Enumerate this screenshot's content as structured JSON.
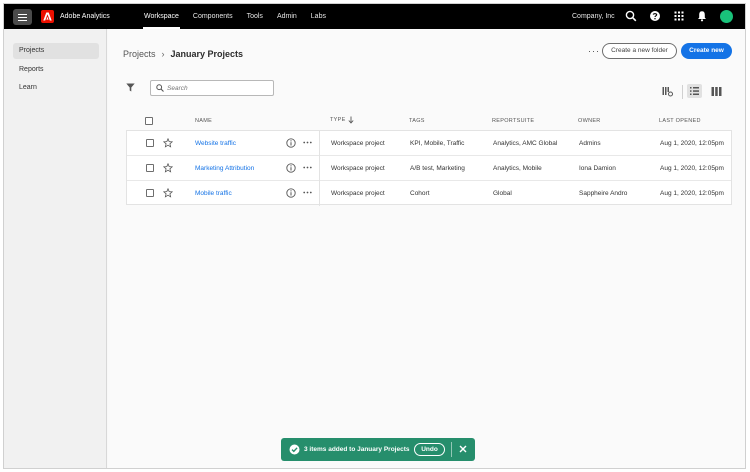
{
  "topbar": {
    "app_title": "Adobe Analytics",
    "nav": [
      "Workspace",
      "Components",
      "Tools",
      "Admin",
      "Labs"
    ],
    "company": "Company, Inc"
  },
  "sidebar": {
    "items": [
      {
        "label": "Projects",
        "active": true
      },
      {
        "label": "Reports"
      },
      {
        "label": "Learn"
      }
    ]
  },
  "breadcrumb": {
    "parent": "Projects",
    "separator": "›",
    "current": "January Projects"
  },
  "actions": {
    "more": "···",
    "create_folder": "Create a new folder",
    "create_new": "Create new"
  },
  "search": {
    "placeholder": "Search"
  },
  "table": {
    "headers": {
      "name": "NAME",
      "type": "TYPE",
      "tags": "TAGS",
      "reportsuite": "REPORTSUITE",
      "owner": "OWNER",
      "last_opened": "LAST OPENED"
    },
    "rows": [
      {
        "name": "Website traffic",
        "type": "Workspace project",
        "tags": "KPI, Mobile, Traffic",
        "reportsuite": "Analytics, AMC Global",
        "owner": "Admins",
        "last_opened": "Aug 1, 2020, 12:05pm"
      },
      {
        "name": "Marketing Attribution",
        "type": "Workspace project",
        "tags": "A/B test, Marketing",
        "reportsuite": "Analytics, Mobile",
        "owner": "Iona Damion",
        "last_opened": "Aug 1, 2020, 12:05pm"
      },
      {
        "name": "Mobile traffic",
        "type": "Workspace project",
        "tags": "Cohort",
        "reportsuite": "Global",
        "owner": "Sappheire Andro",
        "last_opened": "Aug 1, 2020, 12:05pm"
      }
    ]
  },
  "toast": {
    "message": "3 items added to January Projects",
    "undo": "Undo"
  },
  "colors": {
    "accent": "#1473e6",
    "toast": "#268e6c",
    "brand": "#eb1000",
    "avatar": "#19c27a"
  },
  "icons": [
    "menu-icon",
    "adobe-logo-icon",
    "search-icon",
    "help-icon",
    "apps-grid-icon",
    "bell-icon",
    "filter-icon",
    "star-icon",
    "info-icon",
    "more-icon",
    "sort-down-icon",
    "checkmark-circle-icon",
    "close-icon"
  ]
}
